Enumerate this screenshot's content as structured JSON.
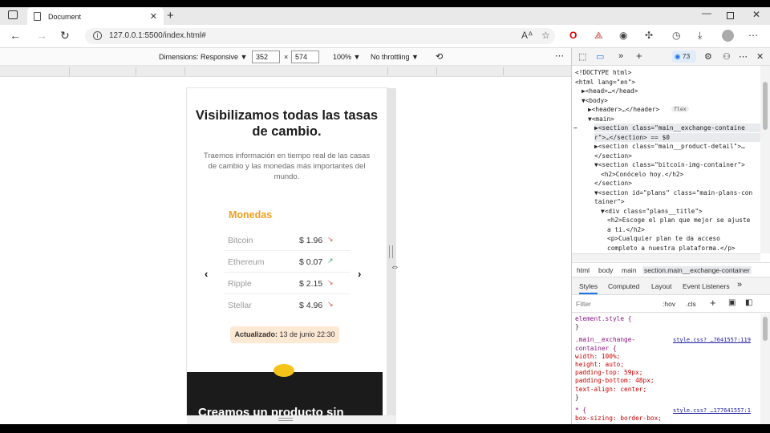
{
  "browser": {
    "tab_title": "Document",
    "url": "127.0.0.1:5500/index.html#"
  },
  "device_toolbar": {
    "dimensions": "Dimensions: Responsive",
    "width": "352",
    "times": "×",
    "height": "574",
    "zoom": "100%",
    "throttling": "No throttling"
  },
  "page": {
    "title": "Visibilizamos todas las tasas de cambio.",
    "description": "Traemos información en tiempo real de las casas de cambio y las monedas más importantes del mundo.",
    "coins_title": "Monedas",
    "coins": [
      {
        "name": "Bitcoin",
        "price": "$ 1.96",
        "trend": "down"
      },
      {
        "name": "Ethereum",
        "price": "$ 0.07",
        "trend": "up"
      },
      {
        "name": "Ripple",
        "price": "$ 2.15",
        "trend": "down"
      },
      {
        "name": "Stellar",
        "price": "$ 4.96",
        "trend": "down"
      }
    ],
    "updated_label": "Actualizado:",
    "updated_value": "13 de junio 22:30",
    "next_heading": "Creamos un producto sin"
  },
  "devtools": {
    "issues_count": "73",
    "dom_lines": [
      {
        "indent": 0,
        "text": "<!DOCTYPE html>"
      },
      {
        "indent": 0,
        "text": "<html lang=\"en\">"
      },
      {
        "indent": 1,
        "text": "▶<head>…</head>"
      },
      {
        "indent": 1,
        "text": "▼<body>"
      },
      {
        "indent": 2,
        "text": "▶<header>…</header>",
        "badge": "flex"
      },
      {
        "indent": 2,
        "text": "▼<main>"
      },
      {
        "indent": 3,
        "text": "▶<section class=\"main__exchange-containe",
        "selected": true
      },
      {
        "indent": 3,
        "text": "r\">…</section> == $0",
        "selected": true
      },
      {
        "indent": 3,
        "text": "▶<section class=\"main__product-detail\">…"
      },
      {
        "indent": 3,
        "text": "</section>"
      },
      {
        "indent": 3,
        "text": "▼<section class=\"bitcoin-img-container\">"
      },
      {
        "indent": 4,
        "text": "<h2>Conócelo hoy.</h2>"
      },
      {
        "indent": 3,
        "text": "</section>"
      },
      {
        "indent": 3,
        "text": "▼<section id=\"plans\" class=\"main-plans-con"
      },
      {
        "indent": 3,
        "text": "tainer\">"
      },
      {
        "indent": 4,
        "text": "▼<div class=\"plans__title\">"
      },
      {
        "indent": 5,
        "text": "<h2>Escoge el plan que mejor se ajuste"
      },
      {
        "indent": 5,
        "text": "a ti.</h2>"
      },
      {
        "indent": 5,
        "text": "<p>Cualquier plan te da acceso"
      },
      {
        "indent": 5,
        "text": "completo a nuestra plataforma.</p>"
      }
    ],
    "breadcrumbs": [
      "html",
      "body",
      "main",
      "section.main__exchange-container"
    ],
    "style_tabs": [
      "Styles",
      "Computed",
      "Layout",
      "Event Listeners"
    ],
    "filter_placeholder": "Filter",
    "hov": ":hov",
    "cls": ".cls",
    "style_lines": [
      {
        "kind": "selector",
        "text": "element.style {"
      },
      {
        "kind": "plain",
        "text": "}"
      },
      {
        "kind": "selector",
        "text": ".main__exchange-",
        "link": "style.css? …7641557:119"
      },
      {
        "kind": "selector",
        "text": "container {"
      },
      {
        "kind": "prop",
        "text": "  width: 100%;"
      },
      {
        "kind": "prop",
        "text": "  height: auto;"
      },
      {
        "kind": "prop",
        "text": "  padding-top: 59px;"
      },
      {
        "kind": "prop",
        "text": "  padding-bottom: 48px;"
      },
      {
        "kind": "prop",
        "text": "  text-align: center;"
      },
      {
        "kind": "plain",
        "text": "}"
      },
      {
        "kind": "selector",
        "text": "* {",
        "link": "style.css? …177641557:1"
      },
      {
        "kind": "prop",
        "text": "  box-sizing: border-box;"
      }
    ]
  }
}
